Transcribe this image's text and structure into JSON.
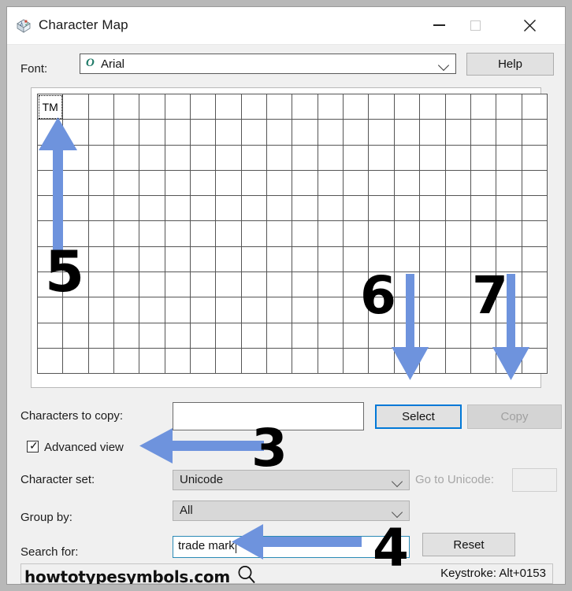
{
  "window": {
    "title": "Character Map",
    "icon": "character-map-icon",
    "minimize_label": "–",
    "maximize_label": "□",
    "close_label": "✕"
  },
  "font_row": {
    "label": "Font:",
    "font_type_icon": "O",
    "selected_font": "Arial",
    "help_label": "Help"
  },
  "grid": {
    "columns": 20,
    "rows": 11,
    "cells": [
      {
        "char": "TM",
        "focused": true
      }
    ]
  },
  "copy_row": {
    "label": "Characters to copy:",
    "value": "",
    "select_label": "Select",
    "copy_label": "Copy"
  },
  "advanced": {
    "label": "Advanced view",
    "checked": true,
    "check_glyph": "✓"
  },
  "charset_row": {
    "label": "Character set:",
    "value": "Unicode",
    "goto_label": "Go to Unicode:",
    "goto_value": ""
  },
  "groupby_row": {
    "label": "Group by:",
    "value": "All"
  },
  "search_row": {
    "label": "Search for:",
    "value": "trade mark",
    "reset_label": "Reset"
  },
  "status": {
    "keystroke": "Keystroke: Alt+0153"
  },
  "watermark": {
    "text": "howtotypesymbols.com",
    "icon": "magnifier-icon"
  },
  "annotations": {
    "arrow_color": "#6e93dd",
    "items": [
      {
        "number": "3",
        "target": "advanced-view-checkbox"
      },
      {
        "number": "4",
        "target": "search-for-input"
      },
      {
        "number": "5",
        "target": "character-grid-first-cell"
      },
      {
        "number": "6",
        "target": "character-grid-column-15"
      },
      {
        "number": "7",
        "target": "character-grid-column-19"
      }
    ]
  }
}
